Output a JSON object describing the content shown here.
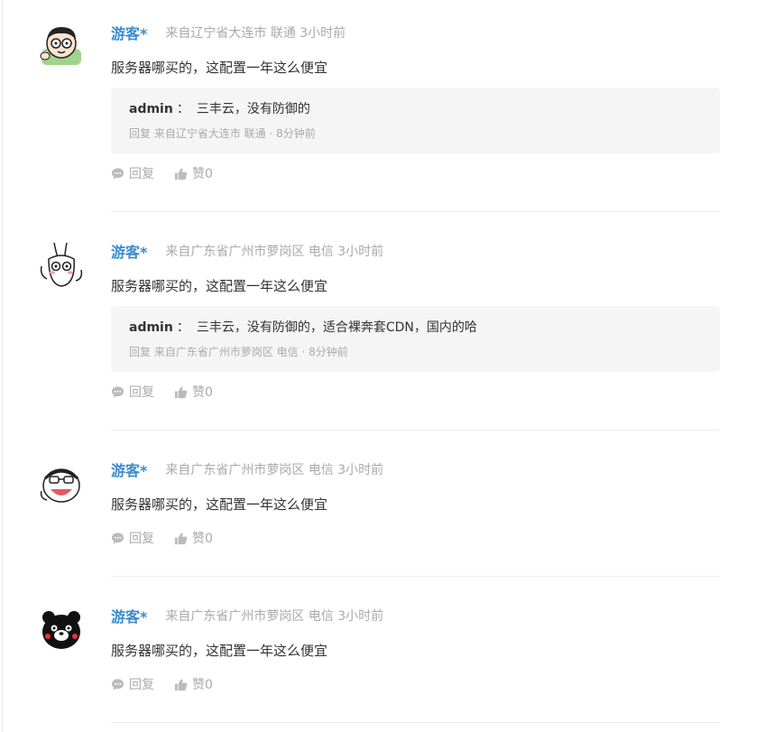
{
  "comments": [
    {
      "author": "游客*",
      "origin": "来自辽宁省大连市 联通 3小时前",
      "content": "服务器哪买的，这配置一年这么便宜",
      "reply": {
        "author": "admin",
        "sep": "：",
        "text": "三丰云，没有防御的",
        "meta": "回复 来自辽宁省大连市 联通 · 8分钟前"
      },
      "reply_label": "回复",
      "like_label": "赞0"
    },
    {
      "author": "游客*",
      "origin": "来自广东省广州市萝岗区 电信 3小时前",
      "content": "服务器哪买的，这配置一年这么便宜",
      "reply": {
        "author": "admin",
        "sep": "：",
        "text": "三丰云，没有防御的，适合裸奔套CDN，国内的哈",
        "meta": "回复 来自广东省广州市萝岗区 电信 · 8分钟前"
      },
      "reply_label": "回复",
      "like_label": "赞0"
    },
    {
      "author": "游客*",
      "origin": "来自广东省广州市萝岗区 电信 3小时前",
      "content": "服务器哪买的，这配置一年这么便宜",
      "reply_label": "回复",
      "like_label": "赞0"
    },
    {
      "author": "游客*",
      "origin": "来自广东省广州市萝岗区 电信 3小时前",
      "content": "服务器哪买的，这配置一年这么便宜",
      "reply_label": "回复",
      "like_label": "赞0"
    }
  ],
  "icons": {
    "reply": "chat-bubble-icon",
    "like": "thumbs-up-icon"
  },
  "colors": {
    "author": "#3b8bcc",
    "muted": "#aaaaaa",
    "reply_bg": "#f5f5f5"
  }
}
